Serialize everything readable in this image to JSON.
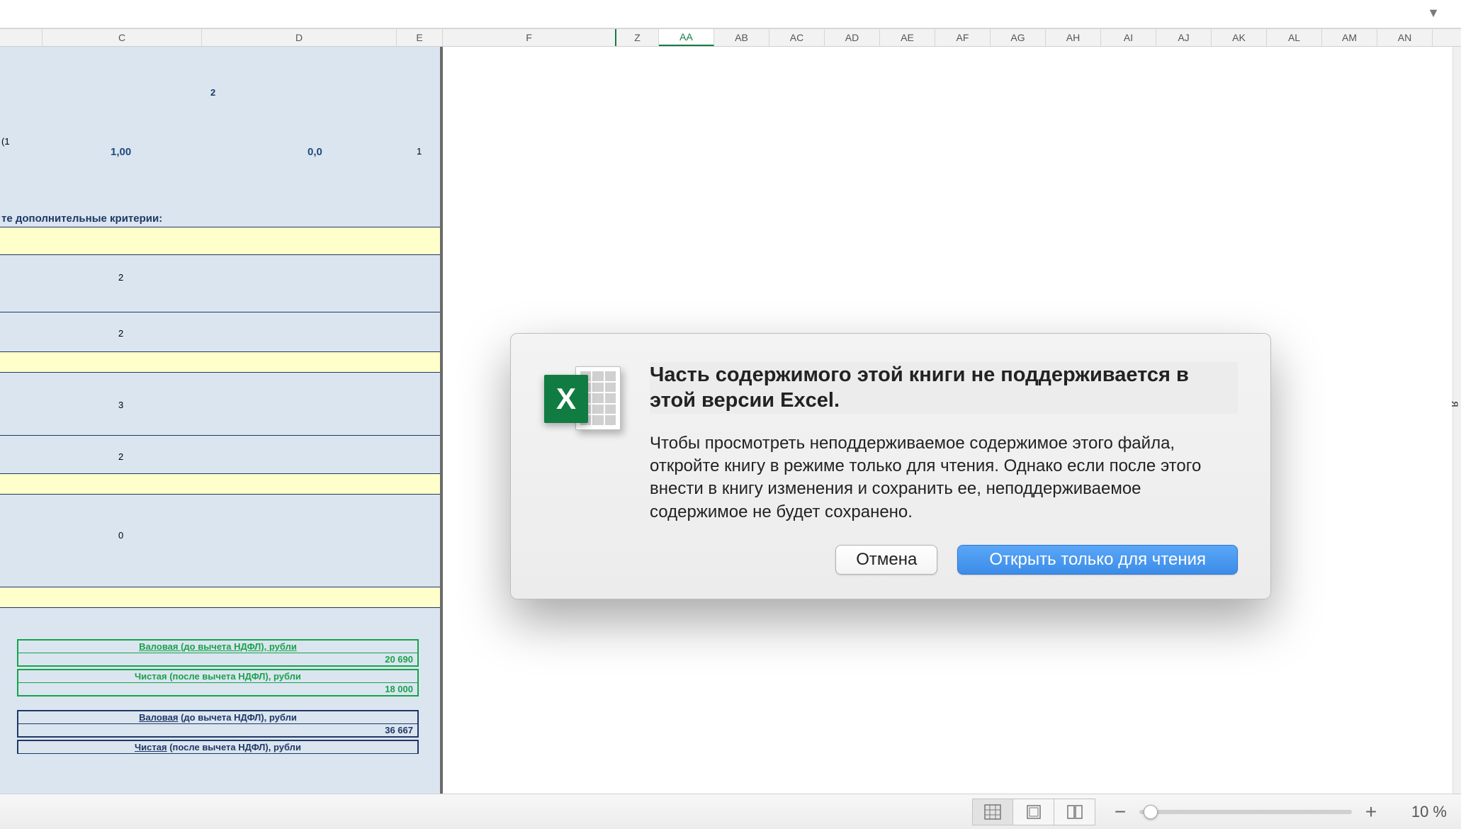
{
  "columns": {
    "C": "C",
    "D": "D",
    "E": "E",
    "F": "F",
    "Z": "Z",
    "AA": "AA",
    "AB": "AB",
    "AC": "AC",
    "AD": "AD",
    "AE": "AE",
    "AF": "AF",
    "AG": "AG",
    "AH": "AH",
    "AI": "AI",
    "AJ": "AJ",
    "AK": "AK",
    "AL": "AL",
    "AM": "AM",
    "AN": "AN"
  },
  "sheet": {
    "row3_left": "(1",
    "row3_c": "1,00",
    "row3_d": "0,0",
    "row3_e": "1",
    "row1_d": "2",
    "criteria_label": "те дополнительные критерии:",
    "val_c_a": "2",
    "val_c_b": "2",
    "val_c_c": "3",
    "val_c_d": "2",
    "val_c_e": "0",
    "green_hdr1": "Валовая (до вычета НДФЛ), рубли",
    "green_val1": "20 690",
    "green_hdr2": "Чистая (после вычета НДФЛ), рубли",
    "green_val2": "18 000",
    "navy_hdr1_a": "Валовая",
    "navy_hdr1_b": " (до вычета НДФЛ), рубли",
    "navy_val1": "36 667",
    "navy_hdr2_a": "Чистая",
    "navy_hdr2_b": " (после вычета НДФЛ), рубли"
  },
  "dialog": {
    "icon_letter": "X",
    "title": "Часть содержимого этой книги не поддерживается в этой версии Excel.",
    "body": "Чтобы просмотреть неподдерживаемое содержимое этого файла, откройте книгу в режиме только для чтения. Однако если после этого внести в книгу изменения и сохранить ее, неподдерживаемое содержимое не будет сохранено.",
    "cancel": "Отмена",
    "open_ro": "Открыть только для чтения"
  },
  "statusbar": {
    "zoom": "10 %"
  },
  "edge_char": "я"
}
